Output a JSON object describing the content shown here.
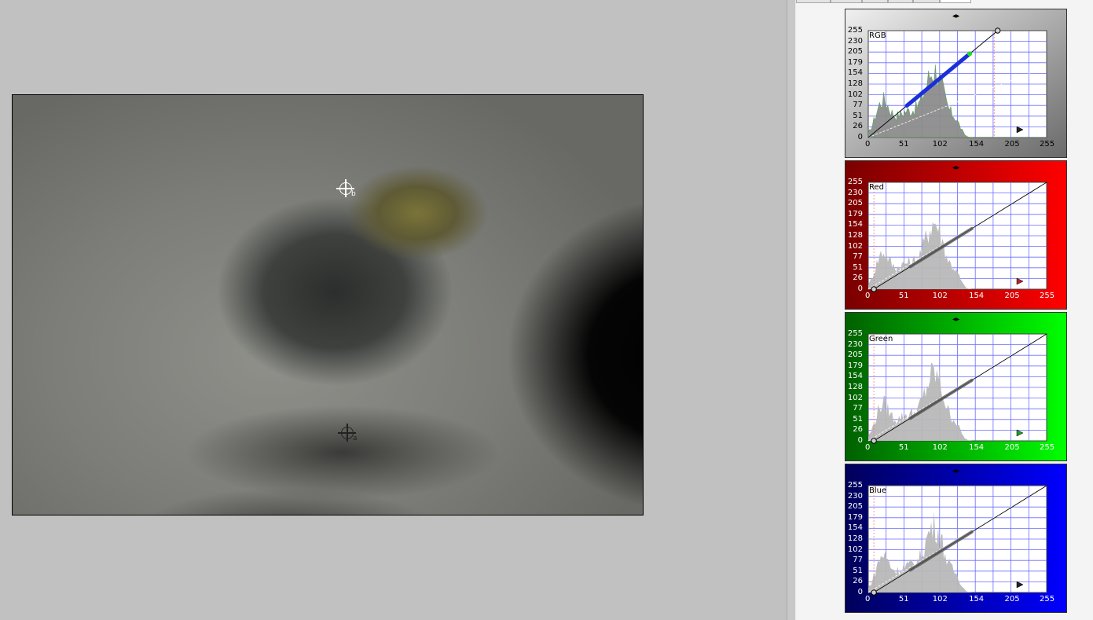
{
  "viewport": {
    "targets": [
      {
        "label": "b"
      },
      {
        "label": "a"
      }
    ]
  },
  "panel": {
    "tabs": [
      "",
      "",
      "",
      "",
      "",
      ""
    ],
    "y_ticks": [
      "255",
      "230",
      "205",
      "179",
      "154",
      "128",
      "102",
      "77",
      "51",
      "26",
      "0"
    ],
    "x_ticks": [
      "0",
      "51",
      "102",
      "154",
      "205",
      "255"
    ],
    "channels": [
      {
        "name": "RGB",
        "key": "rgb",
        "curve_color": "#1b2fd8",
        "accent": "#22dd22"
      },
      {
        "name": "Red",
        "key": "red",
        "curve_color": "#555555"
      },
      {
        "name": "Green",
        "key": "green",
        "curve_color": "#555555"
      },
      {
        "name": "Blue",
        "key": "blue",
        "curve_color": "#555555"
      }
    ],
    "icons": {
      "top_arrow": "up-down-arrow-icon",
      "right_marker": "play-triangle-icon",
      "curve_point": "curve-control-point-icon"
    }
  },
  "colors": {
    "background": "#c1c1c1",
    "red_gradient": [
      "#7a0000",
      "#ff0000"
    ],
    "green_gradient": [
      "#006000",
      "#00ff00"
    ],
    "blue_gradient": [
      "#00005a",
      "#0000ff"
    ],
    "rgb_gradient": [
      "#6a6a6a",
      "#f0f0f0"
    ],
    "grid": "#6b6bff"
  }
}
